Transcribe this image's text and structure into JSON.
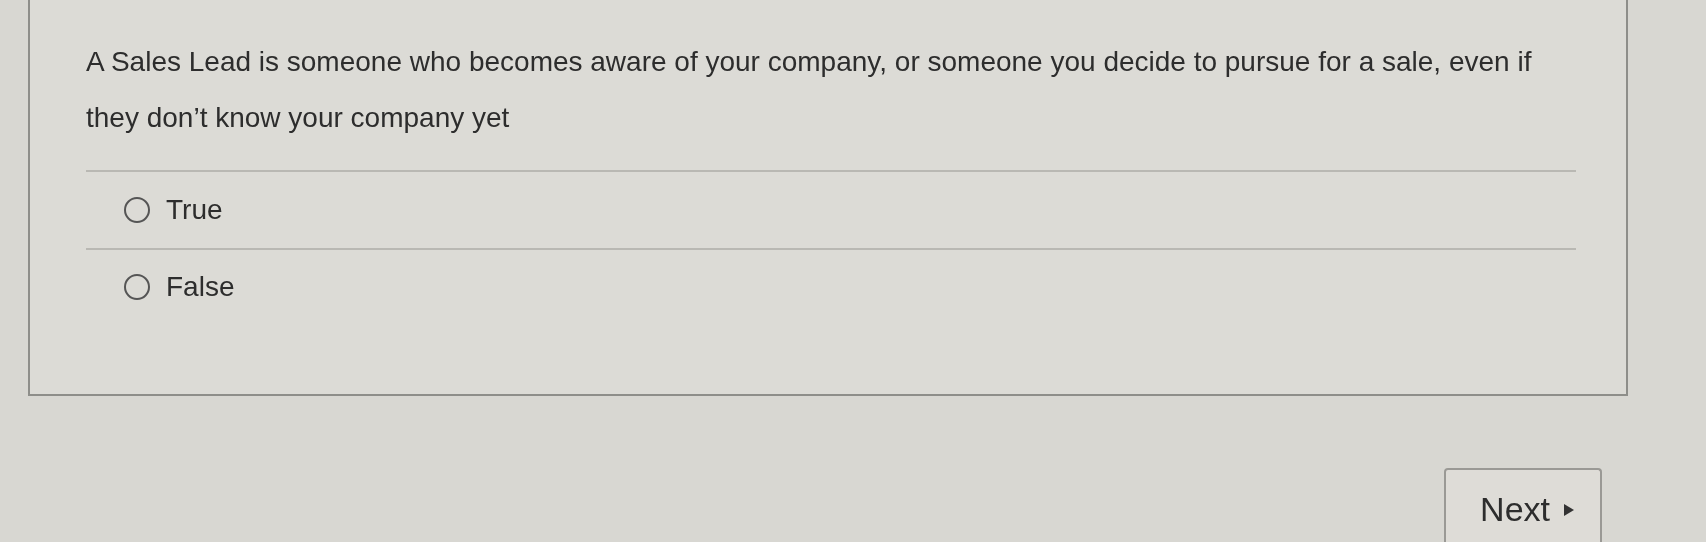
{
  "question": "A Sales Lead is someone who becomes aware of your company, or someone you decide to pursue for a sale, even if they don’t know your company yet",
  "options": [
    {
      "label": "True",
      "selected": false
    },
    {
      "label": "False",
      "selected": false
    }
  ],
  "next_button": {
    "label": "Next"
  }
}
